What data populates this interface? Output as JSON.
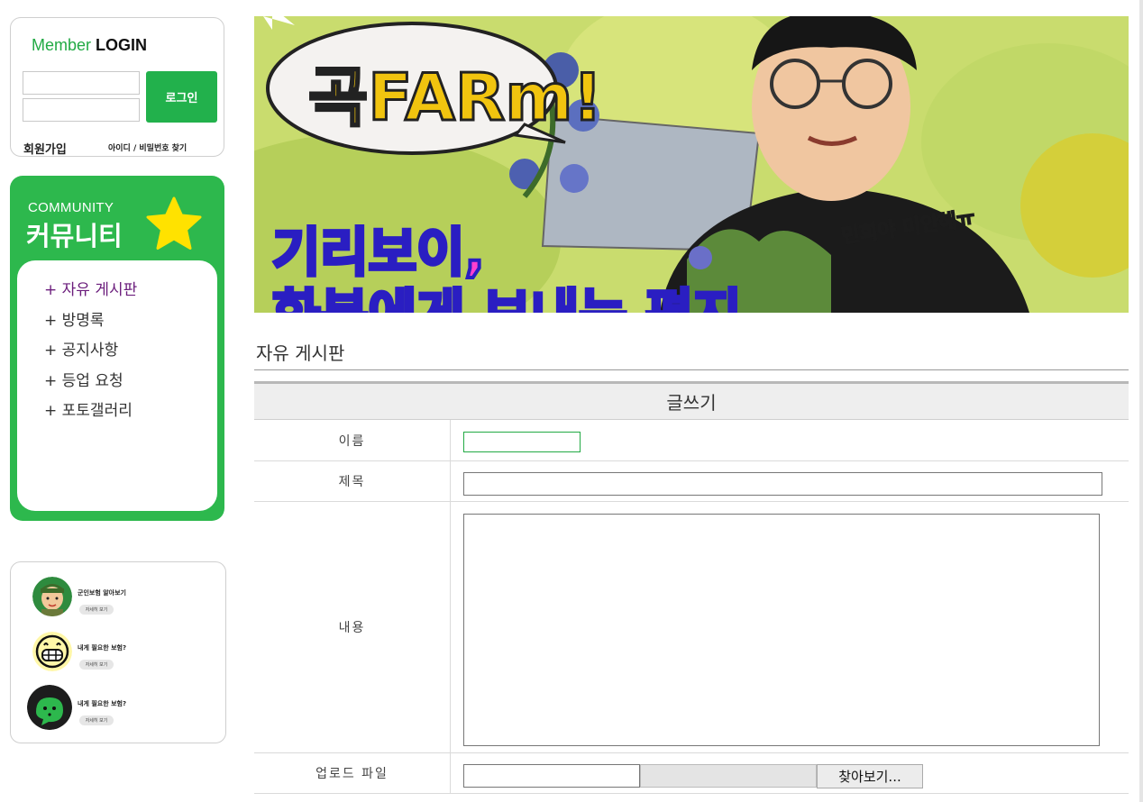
{
  "sidebar": {
    "login": {
      "title_part1": "Member",
      "title_part2": "LOGIN",
      "id_value": "",
      "pw_value": "",
      "login_button": "로그인",
      "join_link": "회원가입",
      "find_link": "아이디 / 비밀번호 찾기"
    },
    "community": {
      "title_en": "COMMUNITY",
      "title_ko": "커뮤니티",
      "items": [
        {
          "label": "+ 자유 게시판"
        },
        {
          "label": "+ 방명록"
        },
        {
          "label": "+ 공지사항"
        },
        {
          "label": "+ 등업 요청"
        },
        {
          "label": "+ 포토갤러리"
        }
      ]
    },
    "banners": [
      {
        "title": "군인보험 알아보기",
        "button": "자세히 보기"
      },
      {
        "title": "내게 필요한 보험?",
        "button": "자세히 보기"
      },
      {
        "title": "내게 필요한 보험?",
        "button": "자세히 보기"
      }
    ]
  },
  "hero": {
    "logo_text": "곡FARm!",
    "caption_line1": "기리보이,",
    "caption_line2": "화분에게 보내는 편지",
    "side_text": "민희야 미안해ㅠ"
  },
  "board": {
    "title": "자유 게시판",
    "form_heading": "글쓰기",
    "fields": {
      "name_label": "이름",
      "subject_label": "제목",
      "content_label": "내용",
      "file_label": "업로드 파일",
      "file_button": "찾아보기..."
    }
  },
  "colors": {
    "accent_green": "#22b14c",
    "active_item": "#6b1d7c"
  }
}
